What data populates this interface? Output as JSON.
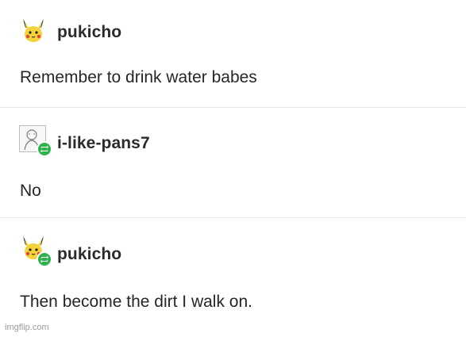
{
  "posts": [
    {
      "username": "pukicho",
      "text": "Remember to drink water babes",
      "avatar": "pikachu-avatar-icon",
      "reblog": false
    },
    {
      "username": "i-like-pans7",
      "text": "No",
      "avatar": "sketch-avatar-icon",
      "reblog": true
    },
    {
      "username": "pukicho",
      "text": "Then become the dirt I walk on.",
      "avatar": "pikachu-avatar-icon",
      "reblog": true
    }
  ],
  "watermark": "imgflip.com",
  "colors": {
    "reblog_badge": "#2fb24c",
    "divider": "#e6e6e6",
    "pikachu_yellow": "#f4d23c"
  }
}
